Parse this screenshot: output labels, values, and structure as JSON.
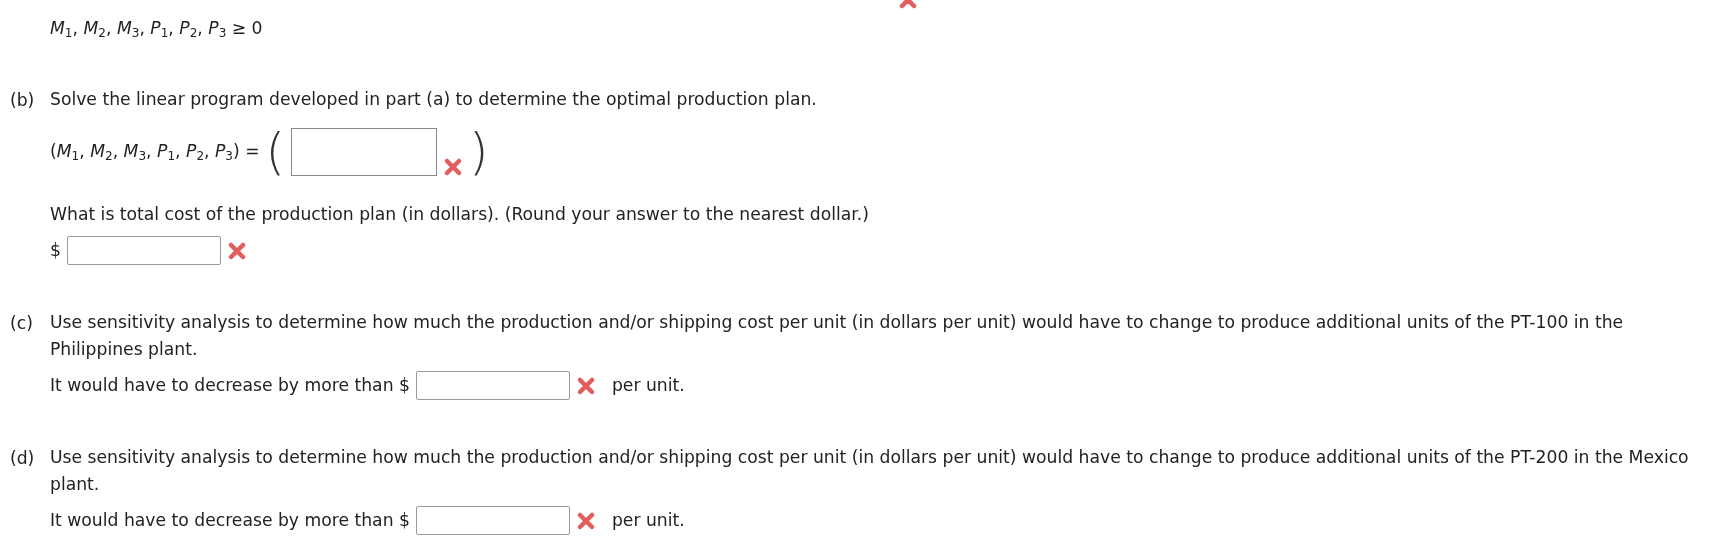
{
  "cut_off_mark": {
    "incorrect": true
  },
  "constraint": "*M*$_{1}$, *M*$_{2}$, *M*$_{3}$, *P*$_{1}$, *P*$_{2}$, *P*$_{3}$ ≥ 0",
  "parts": [
    {
      "label": "(b)",
      "prompt": "Solve the linear program developed in part (a) to determine the optimal production plan.",
      "items": [
        {
          "kind": "tuple",
          "lead": "(*M*$_{1}$, *M*$_{2}$, *M*$_{3}$, *P*$_{1}$, *P*$_{2}$, *P*$_{3}$) =",
          "open": "(",
          "close": ")",
          "incorrect": true
        },
        {
          "kind": "text",
          "text": "What is total cost of the production plan (in dollars). (Round your answer to the nearest dollar.)"
        },
        {
          "kind": "answer",
          "lead": "$",
          "incorrect": true
        }
      ]
    },
    {
      "label": "(c)",
      "prompt": "Use sensitivity analysis to determine how much the production and/or shipping cost per unit (in dollars per unit) would have to change to produce additional units of the PT-100 in the Philippines plant.",
      "items": [
        {
          "kind": "answer",
          "lead": "It would have to decrease by more than $",
          "incorrect": true,
          "suffix": "per unit."
        }
      ]
    },
    {
      "label": "(d)",
      "prompt": "Use sensitivity analysis to determine how much the production and/or shipping cost per unit (in dollars per unit) would have to change to produce additional units of the PT-200 in the Mexico plant.",
      "items": [
        {
          "kind": "answer",
          "lead": "It would have to decrease by more than $",
          "incorrect": true,
          "suffix": "per unit."
        }
      ]
    }
  ]
}
